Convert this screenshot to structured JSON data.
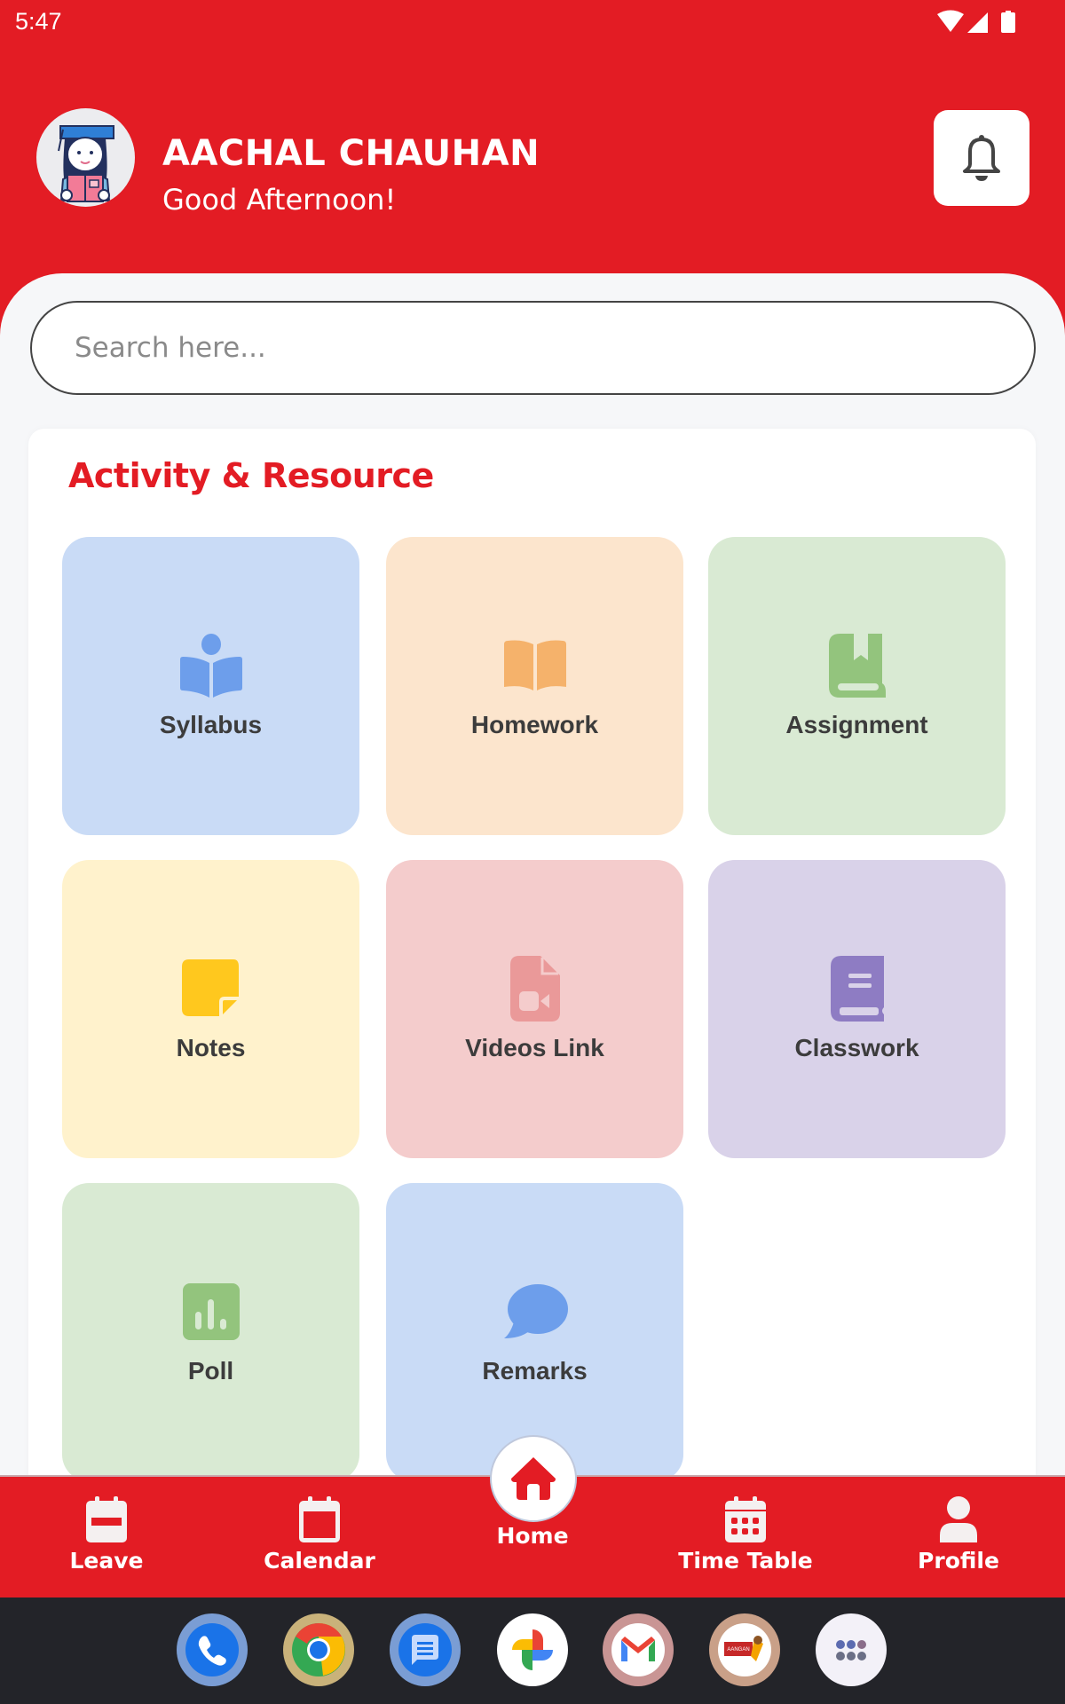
{
  "status_bar": {
    "time": "5:47",
    "icons": [
      "wifi-icon",
      "cellular-signal-icon",
      "battery-icon"
    ]
  },
  "header": {
    "user_name": "AACHAL CHAUHAN",
    "greeting": "Good Afternoon!",
    "avatar": "student-avatar",
    "notification_icon": "bell-icon",
    "brand_color": "#e31c24"
  },
  "search": {
    "placeholder": "Search here...",
    "value": ""
  },
  "section": {
    "title": "Activity & Resource",
    "tiles": [
      {
        "label": "Syllabus",
        "icon": "reading-book-icon",
        "bg": "#c9dbf6",
        "fg": "#6d9eeb"
      },
      {
        "label": "Homework",
        "icon": "open-book-icon",
        "bg": "#fce5cd",
        "fg": "#f5b26b"
      },
      {
        "label": "Assignment",
        "icon": "bookmark-book-icon",
        "bg": "#d9ead3",
        "fg": "#93c47d"
      },
      {
        "label": "Notes",
        "icon": "sticky-note-icon",
        "bg": "#fff2cc",
        "fg": "#ffc81e"
      },
      {
        "label": "Videos Link",
        "icon": "video-file-icon",
        "bg": "#f4cccc",
        "fg": "#ea9999"
      },
      {
        "label": "Classwork",
        "icon": "notebook-icon",
        "bg": "#d9d2e9",
        "fg": "#8e7cc3"
      },
      {
        "label": "Poll",
        "icon": "poll-chart-icon",
        "bg": "#d9ead3",
        "fg": "#93c47d"
      },
      {
        "label": "Remarks",
        "icon": "chat-bubble-icon",
        "bg": "#c9dbf6",
        "fg": "#6d9eeb"
      }
    ]
  },
  "bottom_nav": {
    "items": [
      {
        "label": "Leave",
        "icon": "leave-calendar-icon"
      },
      {
        "label": "Calendar",
        "icon": "calendar-icon"
      },
      {
        "label": "Home",
        "icon": "home-icon",
        "active": true
      },
      {
        "label": "Time Table",
        "icon": "timetable-icon"
      },
      {
        "label": "Profile",
        "icon": "profile-icon"
      }
    ]
  },
  "dock": {
    "apps": [
      {
        "name": "Phone",
        "icon": "phone-icon"
      },
      {
        "name": "Chrome",
        "icon": "chrome-icon"
      },
      {
        "name": "Messages",
        "icon": "messages-icon"
      },
      {
        "name": "Photos",
        "icon": "photos-icon"
      },
      {
        "name": "Gmail",
        "icon": "gmail-icon"
      },
      {
        "name": "Aangan Public School",
        "icon": "aangan-school-icon",
        "badge_text": "AANGAN"
      },
      {
        "name": "App Drawer",
        "icon": "app-drawer-icon"
      }
    ]
  }
}
